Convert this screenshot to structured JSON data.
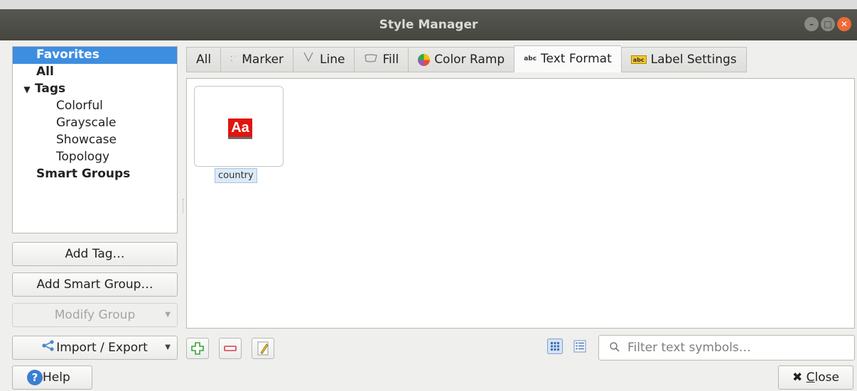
{
  "window": {
    "title": "Style Manager"
  },
  "groups": {
    "items": [
      {
        "label": "Favorites"
      },
      {
        "label": "All"
      },
      {
        "label": "Tags"
      },
      {
        "label": "Colorful"
      },
      {
        "label": "Grayscale"
      },
      {
        "label": "Showcase"
      },
      {
        "label": "Topology"
      },
      {
        "label": "Smart Groups"
      }
    ],
    "selected": "Favorites"
  },
  "left_buttons": {
    "add_tag": "Add Tag…",
    "add_smart_group": "Add Smart Group…",
    "modify_group": "Modify Group",
    "import_export": "Import / Export"
  },
  "tabs": [
    {
      "label": "All",
      "icon": ""
    },
    {
      "label": "Marker",
      "icon": "marker-icon"
    },
    {
      "label": "Line",
      "icon": "line-icon"
    },
    {
      "label": "Fill",
      "icon": "fill-icon"
    },
    {
      "label": "Color Ramp",
      "icon": "color-ramp-icon"
    },
    {
      "label": "Text Format",
      "icon": "text-format-icon",
      "icon_text": "abc"
    },
    {
      "label": "Label Settings",
      "icon": "label-settings-icon",
      "icon_text": "abc"
    }
  ],
  "active_tab": "Text Format",
  "symbols": [
    {
      "name": "country",
      "preview_text": "Aa",
      "preview_color": "#e1140f"
    }
  ],
  "search": {
    "placeholder": "Filter text symbols…",
    "value": ""
  },
  "footer": {
    "help": "Help",
    "close": "Close",
    "close_mnemonic": "C",
    "close_rest": "lose"
  },
  "colors": {
    "selection": "#3d8ee0",
    "close_window": "#ee6a37",
    "add_icon": "#3aa23a",
    "remove_icon": "#d63c4a"
  }
}
